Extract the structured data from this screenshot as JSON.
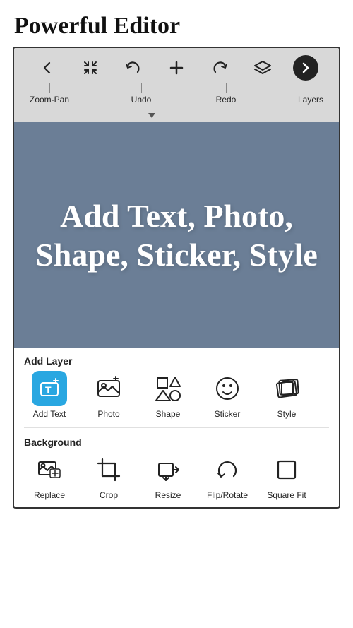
{
  "page": {
    "title": "Powerful Editor"
  },
  "toolbar": {
    "icons": [
      {
        "name": "back-icon",
        "symbol": "←",
        "label": null
      },
      {
        "name": "zoom-pan-icon",
        "symbol": "✋",
        "label": "Zoom-Pan"
      },
      {
        "name": "undo-icon",
        "symbol": "↺",
        "label": "Undo"
      },
      {
        "name": "add-icon",
        "symbol": "+",
        "label": null
      },
      {
        "name": "redo-icon",
        "symbol": "↻",
        "label": "Redo"
      },
      {
        "name": "layers-icon",
        "symbol": "⧉",
        "label": "Layers"
      },
      {
        "name": "next-icon",
        "symbol": "→",
        "label": null
      }
    ]
  },
  "canvas": {
    "text": "Add Text, Photo, Shape, Sticker, Style",
    "background_color": "#6b7e96"
  },
  "add_layer_section": {
    "title": "Add Layer",
    "tools": [
      {
        "name": "add-text-tool",
        "label": "Add Text",
        "icon": "add-text-icon",
        "highlight": true
      },
      {
        "name": "photo-tool",
        "label": "Photo",
        "icon": "photo-icon",
        "highlight": false
      },
      {
        "name": "shape-tool",
        "label": "Shape",
        "icon": "shape-icon",
        "highlight": false
      },
      {
        "name": "sticker-tool",
        "label": "Sticker",
        "icon": "sticker-icon",
        "highlight": false
      },
      {
        "name": "style-tool",
        "label": "Style",
        "icon": "style-icon",
        "highlight": false
      }
    ]
  },
  "background_section": {
    "title": "Background",
    "tools": [
      {
        "name": "replace-tool",
        "label": "Replace",
        "icon": "replace-icon"
      },
      {
        "name": "crop-tool",
        "label": "Crop",
        "icon": "crop-icon"
      },
      {
        "name": "resize-tool",
        "label": "Resize",
        "icon": "resize-icon"
      },
      {
        "name": "flip-rotate-tool",
        "label": "Flip/Rotate",
        "icon": "flip-rotate-icon"
      },
      {
        "name": "square-fit-tool",
        "label": "Square Fit",
        "icon": "square-fit-icon"
      }
    ]
  }
}
